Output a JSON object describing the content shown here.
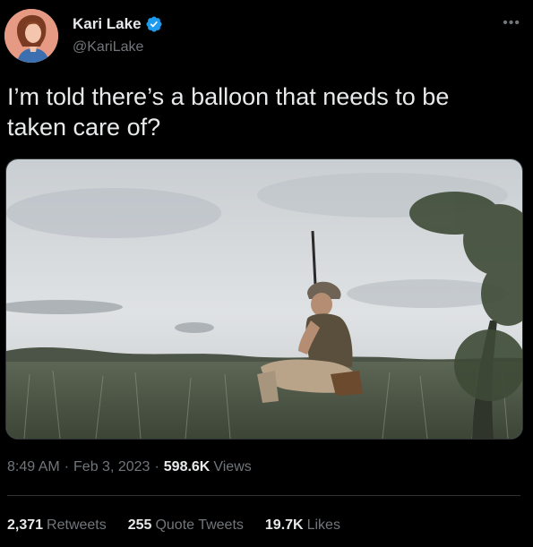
{
  "author": {
    "name": "Kari Lake",
    "handle": "@KariLake",
    "verified": true
  },
  "tweet": {
    "line1": "I’m told there’s a balloon that needs to be",
    "line2": "taken care of?"
  },
  "meta": {
    "time": "8:49 AM",
    "separator": "·",
    "date": "Feb 3, 2023",
    "views_count": "598.6K",
    "views_label": "Views"
  },
  "stats": {
    "retweets_count": "2,371",
    "retweets_label": "Retweets",
    "quotes_count": "255",
    "quotes_label": "Quote Tweets",
    "likes_count": "19.7K",
    "likes_label": "Likes"
  },
  "icons": {
    "verified": "verified-badge-icon",
    "more": "more-options-icon"
  },
  "colors": {
    "background": "#000000",
    "primary_text": "#e7e9ea",
    "secondary_text": "#71767b",
    "verified_blue": "#1d9bf0",
    "divider": "#2f3336"
  }
}
